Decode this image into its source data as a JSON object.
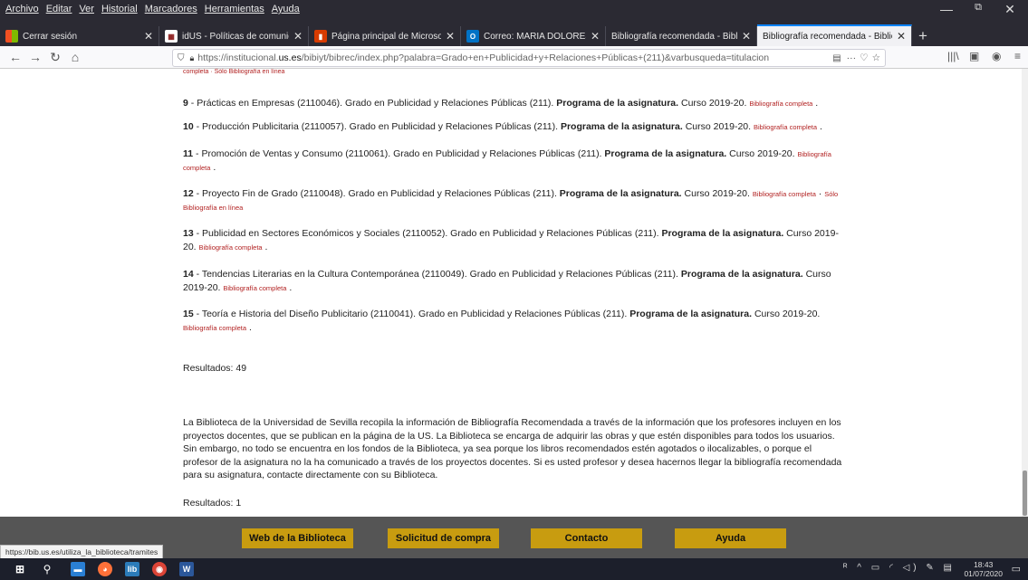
{
  "menu": [
    "Archivo",
    "Editar",
    "Ver",
    "Historial",
    "Marcadores",
    "Herramientas",
    "Ayuda"
  ],
  "window_controls": {
    "minimize": "—",
    "restore": "ǀǀ",
    "close": "✕"
  },
  "tabs": [
    {
      "title": "Cerrar sesión",
      "icon": "microsoft-icon",
      "color": "#f25022"
    },
    {
      "title": "idUS - Políticas de comunicación",
      "icon": "idus-icon",
      "color": "#8b1a1a"
    },
    {
      "title": "Página principal de Microsoft",
      "icon": "office-icon",
      "color": "#d83b01"
    },
    {
      "title": "Correo: MARIA DOLORES RODRÍGUEZ",
      "icon": "outlook-icon",
      "color": "#0072c6"
    },
    {
      "title": "Bibliografía recomendada - Biblioteca",
      "icon": "",
      "color": ""
    },
    {
      "title": "Bibliografía recomendada - Biblioteca",
      "icon": "",
      "color": ""
    }
  ],
  "url": {
    "prefix": "https://institucional.",
    "domain": "us.es",
    "rest": "/bibiyt/bibrec/index.php?palabra=Grado+en+Publicidad+y+Relaciones+Públicas+(211)&varbusqueda=titulacion"
  },
  "nav_icons": {
    "back": "←",
    "forward": "→",
    "reload": "↻",
    "home": "⌂",
    "more": "···",
    "pocket": "♡",
    "star": "☆",
    "library": "|||\\",
    "sidebar": "▣",
    "account": "◉",
    "menu": "≡"
  },
  "cut_link": "completa · Sólo Bibliografía en línea",
  "items": [
    {
      "num": "9",
      "text": "Prácticas en Empresas (2110046). Grado en Publicidad y Relaciones Públicas (211).",
      "prog": "Programa de la asignatura.",
      "course": "Curso 2019-20.",
      "link": "Bibliografía completa",
      "extra": ""
    },
    {
      "num": "10",
      "text": "Producción Publicitaria (2110057). Grado en Publicidad y Relaciones Públicas (211).",
      "prog": "Programa de la asignatura.",
      "course": "Curso 2019-20.",
      "link": "Bibliografía completa",
      "extra": ""
    },
    {
      "num": "11",
      "text": "Promoción de Ventas y Consumo (2110061). Grado en Publicidad y Relaciones Públicas (211).",
      "prog": "Programa de la asignatura.",
      "course": "Curso 2019-20.",
      "link": "Bibliografía completa",
      "extra": ""
    },
    {
      "num": "12",
      "text": "Proyecto Fin de Grado (2110048). Grado en Publicidad y Relaciones Públicas (211).",
      "prog": "Programa de la asignatura.",
      "course": "Curso 2019-20.",
      "link": "Bibliografía completa",
      "extra": "Sólo Bibliografía en línea"
    },
    {
      "num": "13",
      "text": "Publicidad en Sectores Económicos y Sociales (2110052). Grado en Publicidad y Relaciones Públicas (211).",
      "prog": "Programa de la asignatura.",
      "course": "Curso 2019-20.",
      "link": "Bibliografía completa",
      "extra": ""
    },
    {
      "num": "14",
      "text": "Tendencias Literarias en la Cultura Contemporánea (2110049). Grado en Publicidad y Relaciones Públicas (211).",
      "prog": "Programa de la asignatura.",
      "course": "Curso 2019-20.",
      "link": "Bibliografía completa",
      "extra": ""
    },
    {
      "num": "15",
      "text": "Teoría e Historia del Diseño Publicitario (2110041). Grado en Publicidad y Relaciones Públicas (211).",
      "prog": "Programa de la asignatura.",
      "course": "Curso 2019-20.",
      "link": "Bibliografía completa",
      "extra": ""
    }
  ],
  "results1": "Resultados: 49",
  "info_paragraph": "La Biblioteca de la Universidad de Sevilla recopila la información de Bibliografía Recomendada a través de la información que los profesores incluyen en los proyectos docentes, que se publican en la página de la US. La Biblioteca se encarga de adquirir las obras y que estén disponibles para todos los usuarios. Sin embargo, no todo se encuentra en los fondos de la Biblioteca, ya sea porque los libros recomendados estén agotados o ilocalizables, o porque el profesor de la asignatura no la ha comunicado a través de los proyectos docentes. Si es usted profesor y desea hacernos llegar la bibliografía recomendada para su asignatura, contacte directamente con su Biblioteca.",
  "results2": "Resultados: 1",
  "footer_buttons": [
    "Web de la Biblioteca",
    "Solicitud de compra",
    "Contacto",
    "Ayuda"
  ],
  "status_url": "https://bib.us.es/utiliza_la_biblioteca/tramites",
  "taskbar": {
    "time": "18:43",
    "date": "01/07/2020",
    "tray": "ᴿ ^ ▭ ◜ ◁) ✎ ▤"
  }
}
